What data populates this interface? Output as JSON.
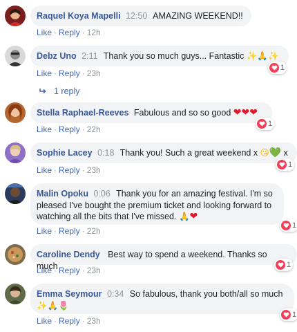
{
  "actions": {
    "like": "Like",
    "reply": "Reply",
    "dot": "·"
  },
  "comments": [
    {
      "name": "Raquel Koya Mapelli",
      "timestamp": "12:50",
      "text": "AMAZING WEEKEND!!",
      "age": "12h"
    },
    {
      "name": "Debz Uno",
      "timestamp": "2:11",
      "text": "Thank you so much guys... Fantastic",
      "age": "23h",
      "reaction_count": "1"
    },
    {
      "name": "Stella Raphael-Reeves",
      "text": "Fabulous and so so good",
      "age": "22h",
      "reaction_count": "1"
    },
    {
      "name": "Sophie Lacey",
      "timestamp": "0:18",
      "text": "Thank you! Such a great weekend x",
      "text_end": "x",
      "age": "23h",
      "reaction_count": "1"
    },
    {
      "name": "Malin Opoku",
      "timestamp": "0:06",
      "text": "Thank you for an amazing festival. I'm so pleased I've bought the premium ticket and looking forward to watching all the bits that I've missed.",
      "age": "22h",
      "reaction_count": "1"
    },
    {
      "name": "Caroline Dendy",
      "text": "Best way to spend a weekend. Thanks so much",
      "age": "23h",
      "reaction_count": "1"
    },
    {
      "name": "Emma Seymour",
      "timestamp": "0:34",
      "text": "So fabulous, thank you both/all so much",
      "age": "23h",
      "reaction_count": "1"
    }
  ],
  "replies_link": "1 reply",
  "colors": {
    "name": "#385898",
    "link": "#4267b2",
    "meta": "#90949c",
    "bubble": "#f2f3f5",
    "heart": "#f33e58"
  },
  "icons": {
    "reply_arrow": "reply-arrow-icon",
    "reaction": "love-reaction-icon"
  }
}
